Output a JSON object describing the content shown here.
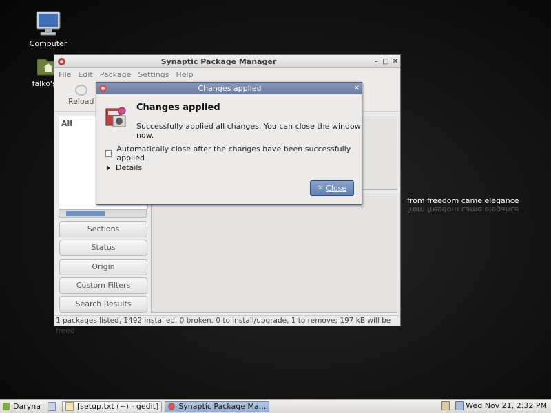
{
  "desktop": {
    "icons": [
      {
        "label": "Computer"
      },
      {
        "label": "falko's H"
      }
    ],
    "wallpaper_text": "from freedom came elegance"
  },
  "synaptic_window": {
    "title": "Synaptic Package Manager",
    "menu": [
      "File",
      "Edit",
      "Package",
      "Settings",
      "Help"
    ],
    "toolbar": {
      "reload_label": "Reload"
    },
    "left_pane": {
      "header": "All"
    },
    "filter_buttons": [
      "Sections",
      "Status",
      "Origin",
      "Custom Filters",
      "Search Results"
    ],
    "status_bar": "1 packages listed, 1492 installed, 0 broken. 0 to install/upgrade, 1 to remove; 197 kB will be freed"
  },
  "dialog": {
    "title": "Changes applied",
    "heading": "Changes applied",
    "message": "Successfully applied all changes. You can close the window now.",
    "checkbox_label": "Automatically close after the changes have been successfully applied",
    "checkbox_checked": false,
    "details_label": "Details",
    "close_label": "Close"
  },
  "taskbar": {
    "user_menu": "Daryna",
    "windows": [
      {
        "label": "[setup.txt (~) - gedit]",
        "active": false
      },
      {
        "label": "Synaptic Package Ma...",
        "active": true
      }
    ],
    "clock": "Wed Nov 21,  2:32 PM"
  }
}
